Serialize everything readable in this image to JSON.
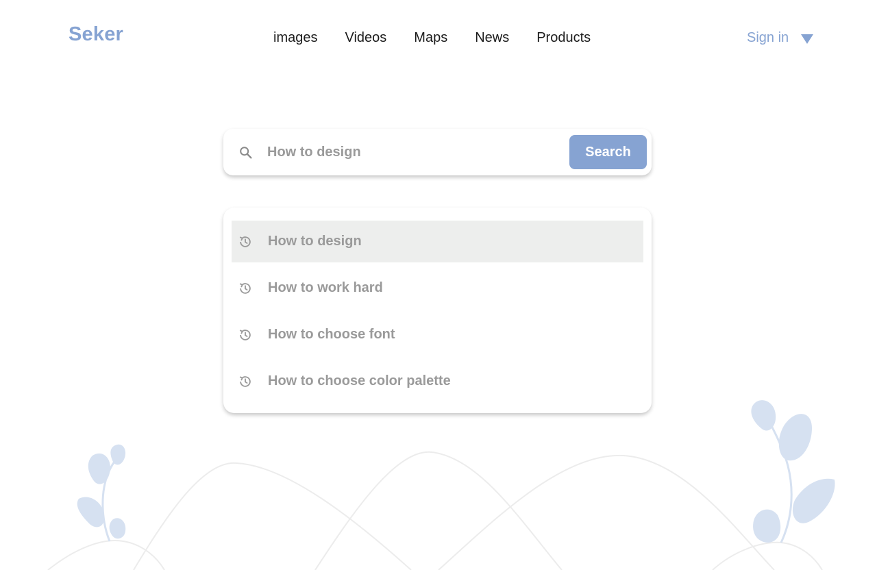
{
  "brand": {
    "name": "Seker",
    "color": "#86a3d2"
  },
  "nav": {
    "items": [
      {
        "label": "images"
      },
      {
        "label": "Videos"
      },
      {
        "label": "Maps"
      },
      {
        "label": "News"
      },
      {
        "label": "Products"
      }
    ]
  },
  "account": {
    "signin_label": "Sign in",
    "caret_icon": "caret-down-icon"
  },
  "search": {
    "placeholder": "How to design",
    "value": "",
    "button_label": "Search",
    "icon": "search-icon"
  },
  "suggestions": {
    "icon": "history-icon",
    "items": [
      {
        "label": "How to design",
        "active": true
      },
      {
        "label": "How to work hard",
        "active": false
      },
      {
        "label": "How to choose font",
        "active": false
      },
      {
        "label": "How to choose color palette",
        "active": false
      }
    ]
  },
  "colors": {
    "accent": "#86a3d2",
    "text": "#1b1b1b",
    "muted": "#9a9a9a",
    "highlight": "#edeeed",
    "plant": "#d6e1f1"
  }
}
